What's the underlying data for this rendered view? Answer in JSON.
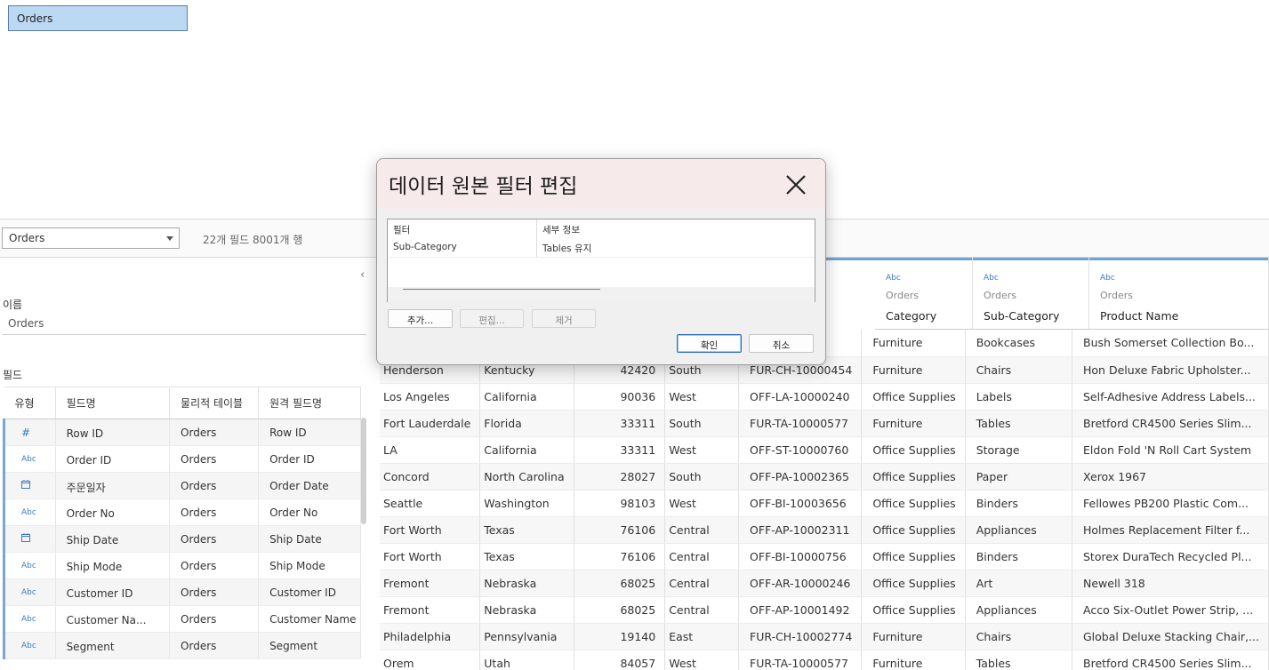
{
  "canvas": {
    "table_pill": "Orders"
  },
  "connection": {
    "selected_table": "Orders",
    "field_count": "22개 필드 8001개 행"
  },
  "metadata": {
    "name_label": "이름",
    "name_value": "Orders",
    "fields_label": "필드",
    "collapse_icon": "chevron-left-icon",
    "headers": [
      "유형",
      "필드명",
      "물리적 테이블",
      "원격 필드명"
    ],
    "rows": [
      {
        "type": "#",
        "name": "Row ID",
        "table": "Orders",
        "remote": "Row ID"
      },
      {
        "type": "Abc",
        "name": "Order ID",
        "table": "Orders",
        "remote": "Order ID"
      },
      {
        "type": "date",
        "name": "주문일자",
        "table": "Orders",
        "remote": "Order Date"
      },
      {
        "type": "Abc",
        "name": "Order No",
        "table": "Orders",
        "remote": "Order No"
      },
      {
        "type": "date",
        "name": "Ship Date",
        "table": "Orders",
        "remote": "Ship Date"
      },
      {
        "type": "Abc",
        "name": "Ship Mode",
        "table": "Orders",
        "remote": "Ship Mode"
      },
      {
        "type": "Abc",
        "name": "Customer ID",
        "table": "Orders",
        "remote": "Customer ID"
      },
      {
        "type": "Abc",
        "name": "Customer Na...",
        "table": "Orders",
        "remote": "Customer Name"
      },
      {
        "type": "Abc",
        "name": "Segment",
        "table": "Orders",
        "remote": "Segment"
      }
    ]
  },
  "grid": {
    "columns": [
      {
        "type": "Abc",
        "source": "Orders",
        "name": "Category"
      },
      {
        "type": "Abc",
        "source": "Orders",
        "name": "Sub-Category"
      },
      {
        "type": "Abc",
        "source": "Orders",
        "name": "Product Name"
      }
    ],
    "rows": [
      [
        "",
        "",
        "",
        "",
        "001798",
        "Furniture",
        "Bookcases",
        "Bush Somerset Collection Bo..."
      ],
      [
        "Henderson",
        "Kentucky",
        "42420",
        "South",
        "FUR-CH-10000454",
        "Furniture",
        "Chairs",
        "Hon Deluxe Fabric Upholster..."
      ],
      [
        "Los Angeles",
        "California",
        "90036",
        "West",
        "OFF-LA-10000240",
        "Office Supplies",
        "Labels",
        "Self-Adhesive Address Labels..."
      ],
      [
        "Fort Lauderdale",
        "Florida",
        "33311",
        "South",
        "FUR-TA-10000577",
        "Furniture",
        "Tables",
        "Bretford CR4500 Series Slim..."
      ],
      [
        "LA",
        "California",
        "33311",
        "West",
        "OFF-ST-10000760",
        "Office Supplies",
        "Storage",
        "Eldon Fold 'N Roll Cart System"
      ],
      [
        "Concord",
        "North Carolina",
        "28027",
        "South",
        "OFF-PA-10002365",
        "Office Supplies",
        "Paper",
        "Xerox 1967"
      ],
      [
        "Seattle",
        "Washington",
        "98103",
        "West",
        "OFF-BI-10003656",
        "Office Supplies",
        "Binders",
        "Fellowes PB200 Plastic Com..."
      ],
      [
        "Fort Worth",
        "Texas",
        "76106",
        "Central",
        "OFF-AP-10002311",
        "Office Supplies",
        "Appliances",
        "Holmes Replacement Filter f..."
      ],
      [
        "Fort Worth",
        "Texas",
        "76106",
        "Central",
        "OFF-BI-10000756",
        "Office Supplies",
        "Binders",
        "Storex DuraTech Recycled Pl..."
      ],
      [
        "Fremont",
        "Nebraska",
        "68025",
        "Central",
        "OFF-AR-10000246",
        "Office Supplies",
        "Art",
        "Newell 318"
      ],
      [
        "Fremont",
        "Nebraska",
        "68025",
        "Central",
        "OFF-AP-10001492",
        "Office Supplies",
        "Appliances",
        "Acco Six-Outlet Power Strip, ..."
      ],
      [
        "Philadelphia",
        "Pennsylvania",
        "19140",
        "East",
        "FUR-CH-10002774",
        "Furniture",
        "Chairs",
        "Global Deluxe Stacking Chair,..."
      ],
      [
        "Orem",
        "Utah",
        "84057",
        "West",
        "FUR-TA-10000577",
        "Furniture",
        "Tables",
        "Bretford CR4500 Series Slim..."
      ]
    ]
  },
  "dialog": {
    "title": "데이터 원본 필터 편집",
    "close_icon": "close-icon",
    "list_headers": [
      "필터",
      "세부 정보"
    ],
    "filters": [
      {
        "filter": "Sub-Category",
        "detail": "Tables 유지"
      }
    ],
    "add_label": "추가...",
    "edit_label": "편집...",
    "remove_label": "제거",
    "ok_label": "확인",
    "cancel_label": "취소"
  },
  "colors": {
    "accent": "#2f6bbd",
    "pill": "#bcd9f3",
    "type_icon": "#3b7bbf"
  }
}
